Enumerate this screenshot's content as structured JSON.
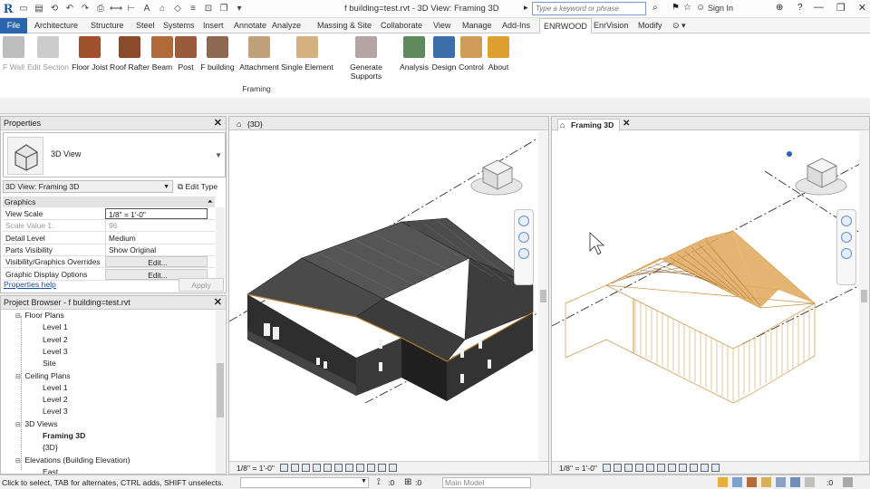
{
  "title_bar": {
    "app_logo": "R",
    "document_title": "f building=test.rvt - 3D View: Framing 3D",
    "search_placeholder": "Type a keyword or phrase",
    "sign_in": "Sign In",
    "minimize": "—",
    "restore": "❐",
    "close": "✕"
  },
  "tabs": [
    "File",
    "Architecture",
    "Structure",
    "Steel",
    "Systems",
    "Insert",
    "Annotate",
    "Analyze",
    "Massing & Site",
    "Collaborate",
    "View",
    "Manage",
    "Add-Ins",
    "ENRWOOD",
    "EnrVision",
    "Modify"
  ],
  "active_tab": "ENRWOOD",
  "ribbon": {
    "buttons": [
      {
        "label": "F Wall",
        "disabled": true,
        "color": "#bdbdbd"
      },
      {
        "label": "Edit Section",
        "disabled": true,
        "color": "#cccccc"
      },
      {
        "label": "Floor Joist",
        "disabled": false,
        "color": "#a0522d"
      },
      {
        "label": "Roof Rafter",
        "disabled": false,
        "color": "#8b4a2b"
      },
      {
        "label": "Beam",
        "disabled": false,
        "color": "#b06a3a"
      },
      {
        "label": "Post",
        "disabled": false,
        "color": "#9a5a3c"
      },
      {
        "label": "F building",
        "disabled": false,
        "color": "#8f6a52"
      },
      {
        "label": "Attachment",
        "disabled": false,
        "color": "#c0a27a"
      },
      {
        "label": "Single Element",
        "disabled": false,
        "color": "#d4b07e"
      },
      {
        "label": "Generate Supports",
        "disabled": false,
        "color": "#b5a4a4"
      },
      {
        "label": "Analysis",
        "disabled": false,
        "color": "#5e8a5e"
      },
      {
        "label": "Design",
        "disabled": false,
        "color": "#3c6ea8"
      },
      {
        "label": "Control",
        "disabled": false,
        "color": "#cf9b58"
      },
      {
        "label": "About",
        "disabled": false,
        "color": "#e0a030"
      }
    ],
    "panel_label": "Framing"
  },
  "properties": {
    "title": "Properties",
    "type_name": "3D View",
    "view_selector": "3D View: Framing 3D",
    "edit_type": "Edit Type",
    "group": "Graphics",
    "rows": [
      {
        "key": "View Scale",
        "value": "1/8\" = 1'-0\"",
        "style": "input"
      },
      {
        "key": "Scale Value    1:",
        "value": "96",
        "style": "dim"
      },
      {
        "key": "Detail Level",
        "value": "Medium",
        "style": ""
      },
      {
        "key": "Parts Visibility",
        "value": "Show Original",
        "style": ""
      },
      {
        "key": "Visibility/Graphics Overrides",
        "value": "Edit...",
        "style": "btn"
      },
      {
        "key": "Graphic Display Options",
        "value": "Edit...",
        "style": "btn"
      }
    ],
    "help": "Properties help",
    "apply": "Apply"
  },
  "browser": {
    "title": "Project Browser - f building=test.rvt",
    "items": [
      {
        "label": "Floor Plans",
        "level": 1,
        "marker": "⊟"
      },
      {
        "label": "Level 1",
        "level": 2,
        "marker": ""
      },
      {
        "label": "Level 2",
        "level": 2,
        "marker": ""
      },
      {
        "label": "Level 3",
        "level": 2,
        "marker": ""
      },
      {
        "label": "Site",
        "level": 2,
        "marker": ""
      },
      {
        "label": "Ceiling Plans",
        "level": 1,
        "marker": "⊟"
      },
      {
        "label": "Level 1",
        "level": 2,
        "marker": ""
      },
      {
        "label": "Level 2",
        "level": 2,
        "marker": ""
      },
      {
        "label": "Level 3",
        "level": 2,
        "marker": ""
      },
      {
        "label": "3D Views",
        "level": 1,
        "marker": "⊟"
      },
      {
        "label": "Framing 3D",
        "level": 2,
        "marker": "",
        "bold": true
      },
      {
        "label": "{3D}",
        "level": 2,
        "marker": ""
      },
      {
        "label": "Elevations (Building Elevation)",
        "level": 1,
        "marker": "⊟"
      },
      {
        "label": "East",
        "level": 2,
        "marker": ""
      }
    ]
  },
  "views": {
    "left_tab": "{3D}",
    "right_tab": "Framing 3D",
    "scale": "1/8\" = 1'-0\""
  },
  "status": {
    "text": "Click to select, TAB for alternates, CTRL adds, SHIFT unselects.",
    "zero1": ":0",
    "zero2": ":0",
    "workset": "Main Model",
    "filter_count": ":0"
  },
  "colors": {
    "file_tab": "#2a64ad",
    "roof": "#3b3b3b",
    "framing": "#c8913e"
  }
}
